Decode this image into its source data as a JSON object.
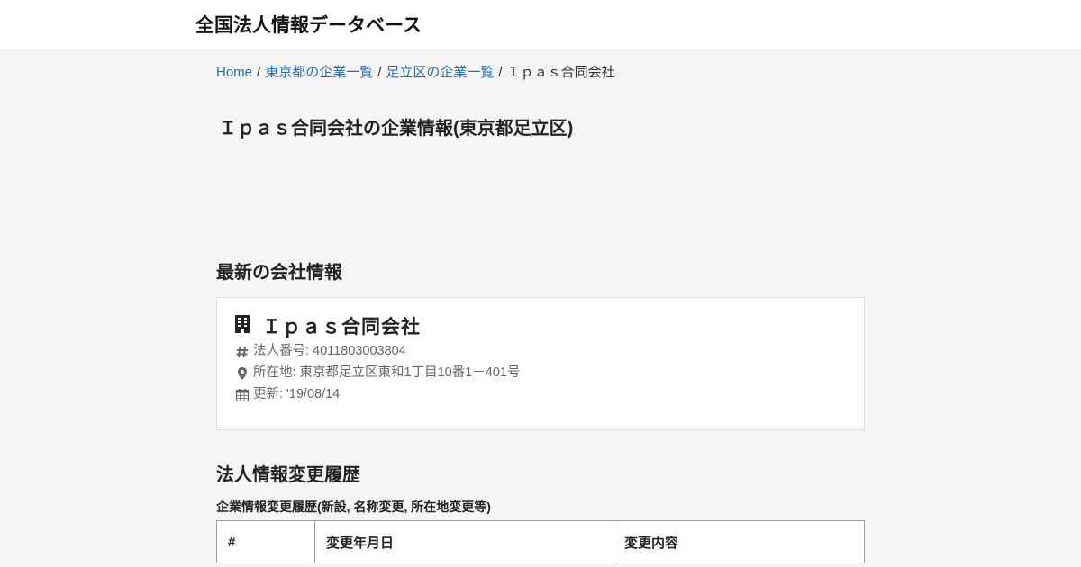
{
  "header": {
    "site_title": "全国法人情報データベース"
  },
  "breadcrumb": {
    "items": [
      {
        "label": "Home"
      },
      {
        "label": "東京都の企業一覧"
      },
      {
        "label": "足立区の企業一覧"
      }
    ],
    "current": "Ｉｐａｓ合同会社",
    "separator": "/"
  },
  "page_title": "Ｉｐａｓ合同会社の企業情報(東京都足立区)",
  "latest": {
    "section_title": "最新の会社情報",
    "company_name": "Ｉｐａｓ合同会社",
    "corp_number_label": "法人番号:",
    "corp_number": "4011803003804",
    "address_label": "所在地:",
    "address": "東京都足立区東和1丁目10番1－401号",
    "updated_label": "更新:",
    "updated": "'19/08/14"
  },
  "history": {
    "section_title": "法人情報変更履歴",
    "subtitle": "企業情報変更履歴(新設, 名称変更, 所在地変更等)",
    "columns": [
      "#",
      "変更年月日",
      "変更内容"
    ]
  },
  "icons": {
    "building": "building-icon",
    "hash": "hashtag-icon",
    "location": "map-marker-icon",
    "calendar": "calendar-icon"
  }
}
